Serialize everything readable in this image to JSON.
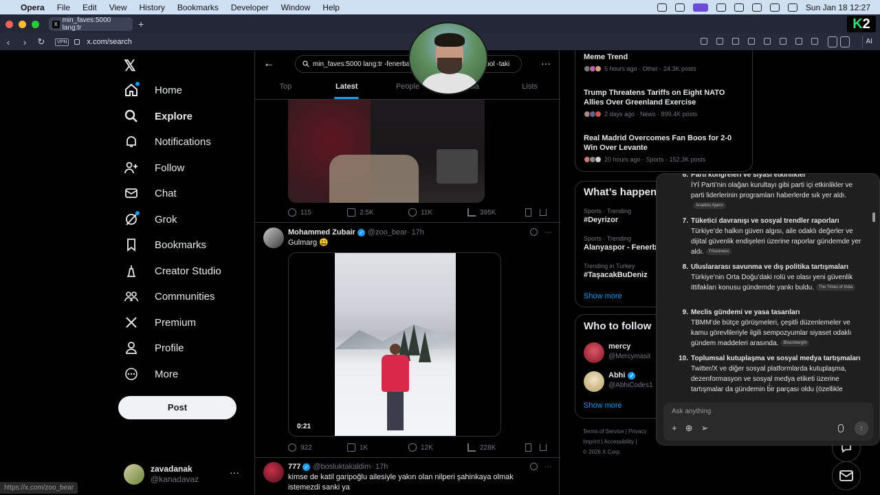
{
  "menubar": {
    "app": "Opera",
    "items": [
      "File",
      "Edit",
      "View",
      "History",
      "Bookmarks",
      "Developer",
      "Window",
      "Help"
    ],
    "datetime": "Sun Jan 18  12:27"
  },
  "browser": {
    "tab_title": "min_faves:5000 lang:tr",
    "url": "x.com/search",
    "vpn": "VPN",
    "ai_label": "AI"
  },
  "nav": {
    "items": [
      {
        "label": "Home",
        "icon": "home-icon"
      },
      {
        "label": "Explore",
        "icon": "search-icon"
      },
      {
        "label": "Notifications",
        "icon": "bell-icon"
      },
      {
        "label": "Follow",
        "icon": "add-user-icon"
      },
      {
        "label": "Chat",
        "icon": "mail-icon"
      },
      {
        "label": "Grok",
        "icon": "grok-icon"
      },
      {
        "label": "Bookmarks",
        "icon": "bookmark-icon"
      },
      {
        "label": "Creator Studio",
        "icon": "creator-icon"
      },
      {
        "label": "Communities",
        "icon": "communities-icon"
      },
      {
        "label": "Premium",
        "icon": "x-icon"
      },
      {
        "label": "Profile",
        "icon": "profile-icon"
      },
      {
        "label": "More",
        "icon": "more-icon"
      }
    ],
    "post": "Post",
    "account": {
      "name": "zavadanak",
      "handle": "@kanadavaz"
    },
    "status_url": "https://x.com/zoo_bear"
  },
  "search": {
    "query": "min_faves:5000 lang:tr -fenerbahce -galatasaray -bjk -futbol -taki",
    "tabs": [
      "Top",
      "Latest",
      "People",
      "Media",
      "Lists"
    ],
    "active_tab": "Latest"
  },
  "posts": [
    {
      "replies": "115",
      "reposts": "2.5K",
      "likes": "11K",
      "views": "395K"
    },
    {
      "name": "Mohammed Zubair",
      "handle": "@zoo_bear",
      "time": "· 17h",
      "text": "Gulmarg 😃",
      "video_time": "0:21",
      "replies": "922",
      "reposts": "1K",
      "likes": "12K",
      "views": "228K"
    },
    {
      "name": "777",
      "handle": "@bosluktakaldim",
      "time": "· 17h",
      "text": "kimse de katil garipoğlu ailesiyle yakın olan nilperi şahinkaya olmak istemezdi sanki ya"
    }
  ],
  "trends_top": [
    {
      "title": "Meme Trend",
      "meta": "5 hours ago · Other · 24.3K posts"
    },
    {
      "title": "Trump Threatens Tariffs on Eight NATO Allies Over Greenland Exercise",
      "meta": "2 days ago · News · 899.4K posts"
    },
    {
      "title": "Real Madrid Overcomes Fan Boos for 2-0 Win Over Levante",
      "meta": "20 hours ago · Sports · 152.3K posts"
    }
  ],
  "happening": {
    "title": "What’s happen",
    "items": [
      {
        "cat": "Sports · Trending",
        "tag": "#Deyrizor"
      },
      {
        "cat": "Sports · Trending",
        "tag": "Alanyaspor - Fenerb"
      },
      {
        "cat": "Trending in Turkey",
        "tag": "#TaşacakBuDeniz"
      }
    ],
    "show_more": "Show more"
  },
  "who_to_follow": {
    "title": "Who to follow",
    "items": [
      {
        "name": "mercy",
        "handle": "@Mercymasit"
      },
      {
        "name": "Abhi",
        "handle": "@AbhiCodes1"
      }
    ],
    "show_more": "Show more"
  },
  "footer": {
    "line1": "Terms of Service  |  Privacy",
    "line2": "Imprint  |  Accessibility  |",
    "line3": "© 2026 X Corp."
  },
  "ai_panel": {
    "items": [
      {
        "num": "6.",
        "head": "Parti kongreleri ve siyasi etkinlikler",
        "body": "İYİ Parti’nin olağan kurultayı gibi parti içi etkinlikler ve parti liderlerinin programları haberlerde sık yer aldı.",
        "src": "Anadolu Ajansı"
      },
      {
        "num": "7.",
        "head": "Tüketici davranışı ve sosyal trendler raporları",
        "body": "Türkiye’de halkın güven algısı, aile odaklı değerler ve dijital güvenlik endişeleri üzerine raporlar gündemde yer aldı.",
        "src": "Trbusiness"
      },
      {
        "num": "8.",
        "head": "Uluslararası savunma ve dış politika tartışmaları",
        "body": "Türkiye’nin Orta Doğu’daki rolü ve olası yeni güvenlik ittifakları konusu gündemde yankı buldu.",
        "src": "The Times of India"
      },
      {
        "num": "9.",
        "head": "Meclis gündemi ve yasa tasarıları",
        "body": "TBMM’de bütçe görüşmeleri, çeşitli düzenlemeler ve kamu görevlileriyle ilgili sempozyumlar siyaset odaklı gündem maddeleri arasında.",
        "src": "Bloomberght"
      },
      {
        "num": "10.",
        "head": "Toplumsal kutuplaşma ve sosyal medya tartışmaları",
        "body": "Twitter/X ve diğer sosyal platformlarda kutuplaşma, dezenformasyon ve sosyal medya etiketi üzerine tartışmalar da gündemin bir parçası oldu (özellikle",
        "src": ""
      }
    ],
    "placeholder": "Ask anything"
  }
}
